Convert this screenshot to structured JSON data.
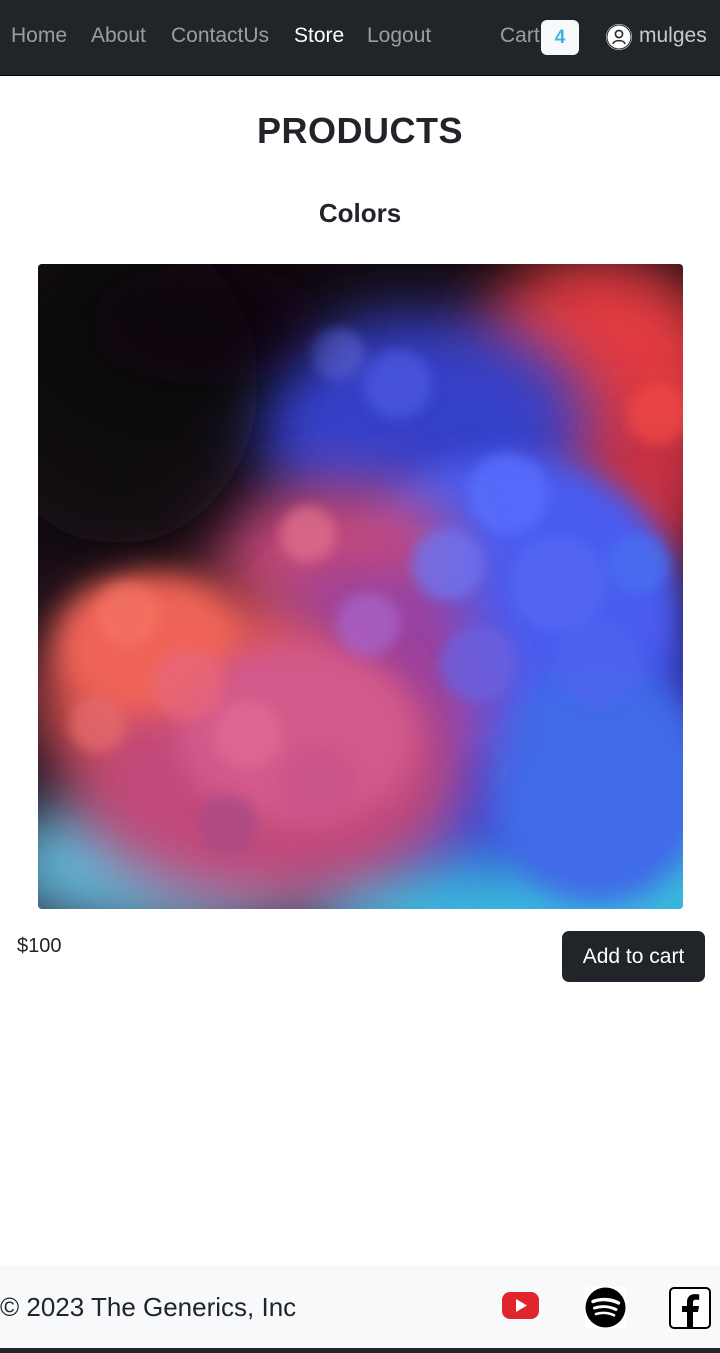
{
  "nav": {
    "links": [
      "Home",
      "About",
      "ContactUs",
      "Store",
      "Logout"
    ],
    "active": "Store",
    "cart_label": "Cart",
    "cart_count": "4",
    "username": "mulges"
  },
  "page": {
    "title": "PRODUCTS"
  },
  "product": {
    "name": "Colors",
    "price": "$100",
    "add_label": "Add to cart"
  },
  "footer": {
    "copyright": "© 2023 The Generics, Inc",
    "social_icons": [
      "youtube-icon",
      "spotify-icon",
      "facebook-icon"
    ]
  },
  "colors": {
    "navbar": "#212529",
    "badge_text": "#3ab7d8",
    "youtube": "#e0262c",
    "button": "#212529"
  }
}
